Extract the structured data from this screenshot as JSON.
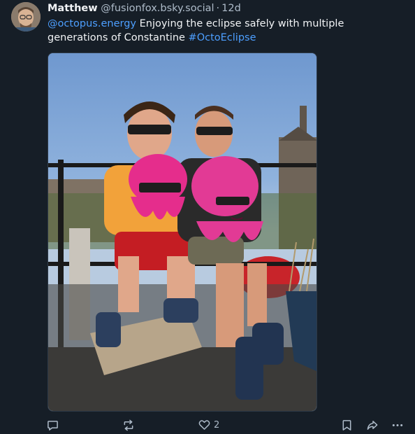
{
  "post": {
    "author": {
      "name": "Matthew",
      "handle": "@fusionfox.bsky.social",
      "separator": "·",
      "time": "12d",
      "avatar_icon": "user-avatar"
    },
    "text": {
      "mention": "@octopus.energy",
      "content": " Enjoying the eclipse safely with multiple generations of Constantine ",
      "hashtag": "#OctoEclipse"
    },
    "actions": {
      "reply_icon": "reply-icon",
      "repost_icon": "repost-icon",
      "like_icon": "heart-icon",
      "like_count": "2",
      "bookmark_icon": "bookmark-icon",
      "share_icon": "share-icon",
      "more_icon": "more-options-icon"
    }
  },
  "colors": {
    "background": "#161e27",
    "text": "#f1f3f5",
    "muted": "#aebbc9",
    "link": "#4d9fff"
  }
}
